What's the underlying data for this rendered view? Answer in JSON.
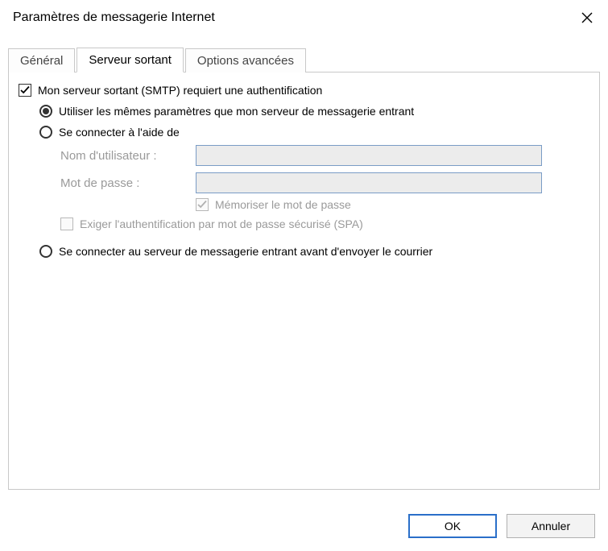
{
  "window": {
    "title": "Paramètres de messagerie Internet"
  },
  "tabs": {
    "general": "Général",
    "outgoing": "Serveur sortant",
    "advanced": "Options avancées",
    "active": "outgoing"
  },
  "smtp": {
    "requires_auth_label": "Mon serveur sortant (SMTP) requiert une authentification",
    "requires_auth_checked": true,
    "radio_same_label": "Utiliser les mêmes paramètres que mon serveur de messagerie entrant",
    "radio_logon_label": "Se connecter à l'aide de",
    "radio_before_send_label": "Se connecter au serveur de messagerie entrant avant d'envoyer le courrier",
    "radio_selected": "same",
    "username_label": "Nom d'utilisateur :",
    "username_value": "",
    "password_label": "Mot de passe :",
    "password_value": "",
    "remember_password_label": "Mémoriser le mot de passe",
    "remember_password_checked": true,
    "spa_label": "Exiger l'authentification par mot de passe sécurisé (SPA)",
    "spa_checked": false
  },
  "buttons": {
    "ok": "OK",
    "cancel": "Annuler"
  }
}
